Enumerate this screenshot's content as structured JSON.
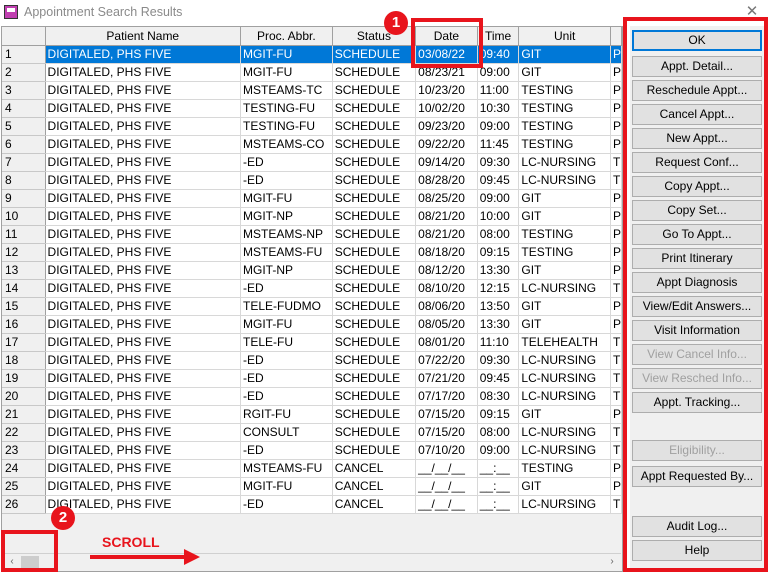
{
  "window": {
    "title": "Appointment Search Results",
    "close_glyph": "✕"
  },
  "grid": {
    "columns": [
      {
        "key": "num",
        "label": "",
        "width": 44
      },
      {
        "key": "name",
        "label": "Patient Name",
        "width": 198
      },
      {
        "key": "proc",
        "label": "Proc. Abbr.",
        "width": 92
      },
      {
        "key": "status",
        "label": "Status",
        "width": 84
      },
      {
        "key": "date",
        "label": "Date",
        "width": 62
      },
      {
        "key": "time",
        "label": "Time",
        "width": 42
      },
      {
        "key": "unit",
        "label": "Unit",
        "width": 92
      },
      {
        "key": "extra",
        "label": "",
        "width": 8
      }
    ],
    "selected_row": 1,
    "rows": [
      [
        "1",
        "DIGITALED, PHS FIVE",
        "MGIT-FU",
        "SCHEDULE",
        "03/08/22",
        "09:40",
        "GIT",
        "P"
      ],
      [
        "2",
        "DIGITALED, PHS FIVE",
        "MGIT-FU",
        "SCHEDULE",
        "08/23/21",
        "09:00",
        "GIT",
        "P"
      ],
      [
        "3",
        "DIGITALED, PHS FIVE",
        "MSTEAMS-TC",
        "SCHEDULE",
        "10/23/20",
        "11:00",
        "TESTING",
        "P"
      ],
      [
        "4",
        "DIGITALED, PHS FIVE",
        "TESTING-FU",
        "SCHEDULE",
        "10/02/20",
        "10:30",
        "TESTING",
        "P"
      ],
      [
        "5",
        "DIGITALED, PHS FIVE",
        "TESTING-FU",
        "SCHEDULE",
        "09/23/20",
        "09:00",
        "TESTING",
        "P"
      ],
      [
        "6",
        "DIGITALED, PHS FIVE",
        "MSTEAMS-CO",
        "SCHEDULE",
        "09/22/20",
        "11:45",
        "TESTING",
        "P"
      ],
      [
        "7",
        "DIGITALED, PHS FIVE",
        "-ED",
        "SCHEDULE",
        "09/14/20",
        "09:30",
        "LC-NURSING",
        "T"
      ],
      [
        "8",
        "DIGITALED, PHS FIVE",
        "-ED",
        "SCHEDULE",
        "08/28/20",
        "09:45",
        "LC-NURSING",
        "T"
      ],
      [
        "9",
        "DIGITALED, PHS FIVE",
        "MGIT-FU",
        "SCHEDULE",
        "08/25/20",
        "09:00",
        "GIT",
        "P"
      ],
      [
        "10",
        "DIGITALED, PHS FIVE",
        "MGIT-NP",
        "SCHEDULE",
        "08/21/20",
        "10:00",
        "GIT",
        "P"
      ],
      [
        "11",
        "DIGITALED, PHS FIVE",
        "MSTEAMS-NP",
        "SCHEDULE",
        "08/21/20",
        "08:00",
        "TESTING",
        "P"
      ],
      [
        "12",
        "DIGITALED, PHS FIVE",
        "MSTEAMS-FU",
        "SCHEDULE",
        "08/18/20",
        "09:15",
        "TESTING",
        "P"
      ],
      [
        "13",
        "DIGITALED, PHS FIVE",
        "MGIT-NP",
        "SCHEDULE",
        "08/12/20",
        "13:30",
        "GIT",
        "P"
      ],
      [
        "14",
        "DIGITALED, PHS FIVE",
        "-ED",
        "SCHEDULE",
        "08/10/20",
        "12:15",
        "LC-NURSING",
        "T"
      ],
      [
        "15",
        "DIGITALED, PHS FIVE",
        "TELE-FUDMO",
        "SCHEDULE",
        "08/06/20",
        "13:50",
        "GIT",
        "P"
      ],
      [
        "16",
        "DIGITALED, PHS FIVE",
        "MGIT-FU",
        "SCHEDULE",
        "08/05/20",
        "13:30",
        "GIT",
        "P"
      ],
      [
        "17",
        "DIGITALED, PHS FIVE",
        "TELE-FU",
        "SCHEDULE",
        "08/01/20",
        "11:10",
        "TELEHEALTH",
        "T"
      ],
      [
        "18",
        "DIGITALED, PHS FIVE",
        "-ED",
        "SCHEDULE",
        "07/22/20",
        "09:30",
        "LC-NURSING",
        "T"
      ],
      [
        "19",
        "DIGITALED, PHS FIVE",
        "-ED",
        "SCHEDULE",
        "07/21/20",
        "09:45",
        "LC-NURSING",
        "T"
      ],
      [
        "20",
        "DIGITALED, PHS FIVE",
        "-ED",
        "SCHEDULE",
        "07/17/20",
        "08:30",
        "LC-NURSING",
        "T"
      ],
      [
        "21",
        "DIGITALED, PHS FIVE",
        "RGIT-FU",
        "SCHEDULE",
        "07/15/20",
        "09:15",
        "GIT",
        "P"
      ],
      [
        "22",
        "DIGITALED, PHS FIVE",
        "CONSULT",
        "SCHEDULE",
        "07/15/20",
        "08:00",
        "LC-NURSING",
        "T"
      ],
      [
        "23",
        "DIGITALED, PHS FIVE",
        "-ED",
        "SCHEDULE",
        "07/10/20",
        "09:00",
        "LC-NURSING",
        "T"
      ],
      [
        "24",
        "DIGITALED, PHS FIVE",
        "MSTEAMS-FU",
        "CANCEL",
        "__/__/__",
        "__:__",
        "TESTING",
        "P"
      ],
      [
        "25",
        "DIGITALED, PHS FIVE",
        "MGIT-FU",
        "CANCEL",
        "__/__/__",
        "__:__",
        "GIT",
        "P"
      ],
      [
        "26",
        "DIGITALED, PHS FIVE",
        "-ED",
        "CANCEL",
        "__/__/__",
        "__:__",
        "LC-NURSING",
        "T"
      ]
    ]
  },
  "scrollbar": {
    "left_arrow": "‹",
    "right_arrow": "›"
  },
  "buttons": [
    {
      "id": "ok",
      "label": "OK",
      "enabled": true
    },
    {
      "id": "appt-detail",
      "label": "Appt. Detail...",
      "enabled": true
    },
    {
      "id": "reschedule-appt",
      "label": "Reschedule Appt...",
      "enabled": true
    },
    {
      "id": "cancel-appt",
      "label": "Cancel Appt...",
      "enabled": true
    },
    {
      "id": "new-appt",
      "label": "New Appt...",
      "enabled": true
    },
    {
      "id": "request-conf",
      "label": "Request Conf...",
      "enabled": true
    },
    {
      "id": "copy-appt",
      "label": "Copy Appt...",
      "enabled": true
    },
    {
      "id": "copy-set",
      "label": "Copy Set...",
      "enabled": true
    },
    {
      "id": "go-to-appt",
      "label": "Go To Appt...",
      "enabled": true
    },
    {
      "id": "print-itinerary",
      "label": "Print Itinerary",
      "enabled": true
    },
    {
      "id": "appt-diagnosis",
      "label": "Appt Diagnosis",
      "enabled": true
    },
    {
      "id": "view-edit-answers",
      "label": "View/Edit Answers...",
      "enabled": true
    },
    {
      "id": "visit-information",
      "label": "Visit Information",
      "enabled": true
    },
    {
      "id": "view-cancel-info",
      "label": "View Cancel Info...",
      "enabled": false
    },
    {
      "id": "view-resched-info",
      "label": "View Resched Info...",
      "enabled": false
    },
    {
      "id": "appt-tracking",
      "label": "Appt. Tracking...",
      "enabled": true
    },
    {
      "id": "eligibility",
      "label": "Eligibility...",
      "enabled": false
    },
    {
      "id": "appt-requested-by",
      "label": "Appt Requested By...",
      "enabled": true
    },
    {
      "id": "audit-log",
      "label": "Audit Log...",
      "enabled": true
    },
    {
      "id": "help",
      "label": "Help",
      "enabled": true
    }
  ],
  "annotations": {
    "badge1": "1",
    "badge2": "2",
    "scroll_label": "SCROLL",
    "color": "#e8141c"
  },
  "colors": {
    "selection": "#0078d7",
    "annotation": "#e8141c"
  }
}
